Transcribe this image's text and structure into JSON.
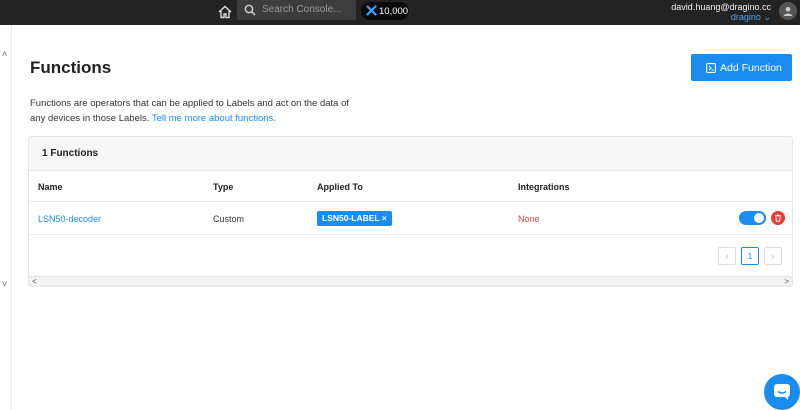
{
  "topbar": {
    "search_placeholder": "Search Console...",
    "credits": "10,000",
    "user_email": "david.huang@dragino.cc",
    "org": "dragino",
    "org_chevron": "⌄"
  },
  "page": {
    "title": "Functions",
    "add_button": "Add Function",
    "description": "Functions are operators that can be applied to Labels and act on the data of any devices in those Labels.",
    "learn_more": "Tell me more about functions."
  },
  "table": {
    "heading": "1 Functions",
    "columns": [
      "Name",
      "Type",
      "Applied To",
      "Integrations"
    ],
    "rows": [
      {
        "name": "LSN50-decoder",
        "type": "Custom",
        "label": "LSN50-LABEL",
        "label_remove": "×",
        "integrations": "None",
        "active": true
      }
    ],
    "pagination": {
      "prev": "‹",
      "current": "1",
      "next": "›"
    }
  },
  "scroll": {
    "up": "˄",
    "down": "˅",
    "left": "<",
    "right": ">"
  },
  "colors": {
    "accent": "#1a8cf0",
    "danger": "#e2403a",
    "topbar": "#232323"
  }
}
